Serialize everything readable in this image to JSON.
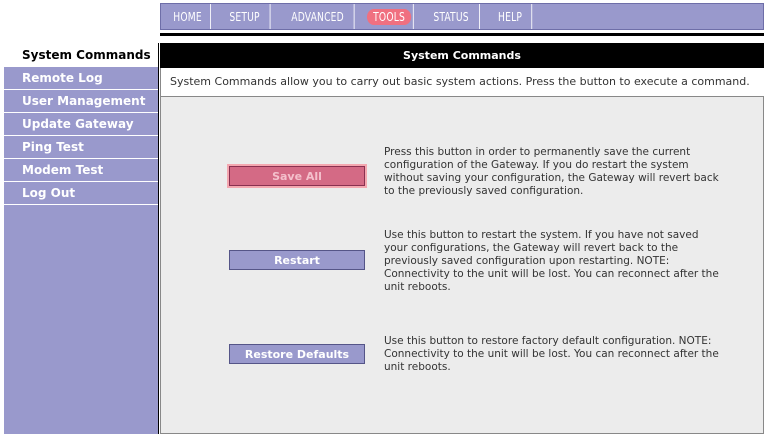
{
  "nav": {
    "items": [
      {
        "label": "HOME",
        "name": "nav-home",
        "active": false
      },
      {
        "label": "SETUP",
        "name": "nav-setup",
        "active": false
      },
      {
        "label": "ADVANCED",
        "name": "nav-advanced",
        "active": false
      },
      {
        "label": "TOOLS",
        "name": "nav-tools",
        "active": true
      },
      {
        "label": "STATUS",
        "name": "nav-status",
        "active": false
      },
      {
        "label": "HELP",
        "name": "nav-help",
        "active": false
      }
    ]
  },
  "sidebar": {
    "items": [
      {
        "label": "System Commands",
        "name": "sidebar-item-system-commands",
        "active": true
      },
      {
        "label": "Remote Log",
        "name": "sidebar-item-remote-log",
        "active": false
      },
      {
        "label": "User Management",
        "name": "sidebar-item-user-management",
        "active": false
      },
      {
        "label": "Update Gateway",
        "name": "sidebar-item-update-gateway",
        "active": false
      },
      {
        "label": "Ping Test",
        "name": "sidebar-item-ping-test",
        "active": false
      },
      {
        "label": "Modem Test",
        "name": "sidebar-item-modem-test",
        "active": false
      },
      {
        "label": "Log Out",
        "name": "sidebar-item-log-out",
        "active": false
      }
    ]
  },
  "main": {
    "title": "System Commands",
    "description": "System Commands allow you to carry out basic system actions. Press the button to execute a command.",
    "commands": [
      {
        "label": "Save All",
        "name": "save-all-button",
        "description": "Press this button in order to permanently save the current configuration of the Gateway. If you do restart the system without saving your configuration, the Gateway will revert back to the previously saved configuration."
      },
      {
        "label": "Restart",
        "name": "restart-button",
        "description": "Use this button to restart the system. If you have not saved your configurations, the Gateway will revert back to the previously saved configuration upon restarting. NOTE: Connectivity to the unit will be lost. You can reconnect after the unit reboots."
      },
      {
        "label": "Restore Defaults",
        "name": "restore-defaults-button",
        "description": "Use this button to restore factory default configuration. NOTE: Connectivity to the unit will be lost. You can reconnect after the unit reboots."
      }
    ]
  },
  "colors": {
    "nav_bg": "#9999cc",
    "active_tab": "#f07080",
    "highlight_button": "#d46a85"
  }
}
